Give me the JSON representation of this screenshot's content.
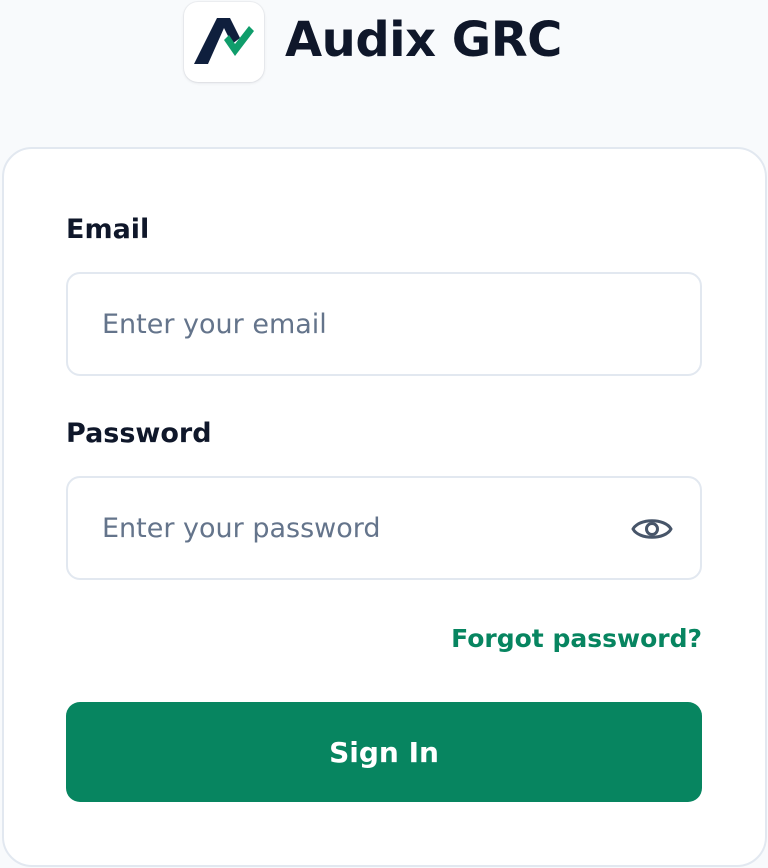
{
  "brand": {
    "name": "Audix GRC",
    "logo_icon": "audix-logo-icon"
  },
  "form": {
    "email": {
      "label": "Email",
      "placeholder": "Enter your email",
      "value": ""
    },
    "password": {
      "label": "Password",
      "placeholder": "Enter your password",
      "value": "",
      "toggle_icon": "eye-icon"
    },
    "forgot_password_label": "Forgot password?",
    "submit_label": "Sign In"
  },
  "colors": {
    "accent": "#078560",
    "heading_text": "#0f172a",
    "placeholder_text": "#64748b",
    "border": "#e2e8f0",
    "page_background": "#f8fafc",
    "card_background": "#ffffff"
  }
}
